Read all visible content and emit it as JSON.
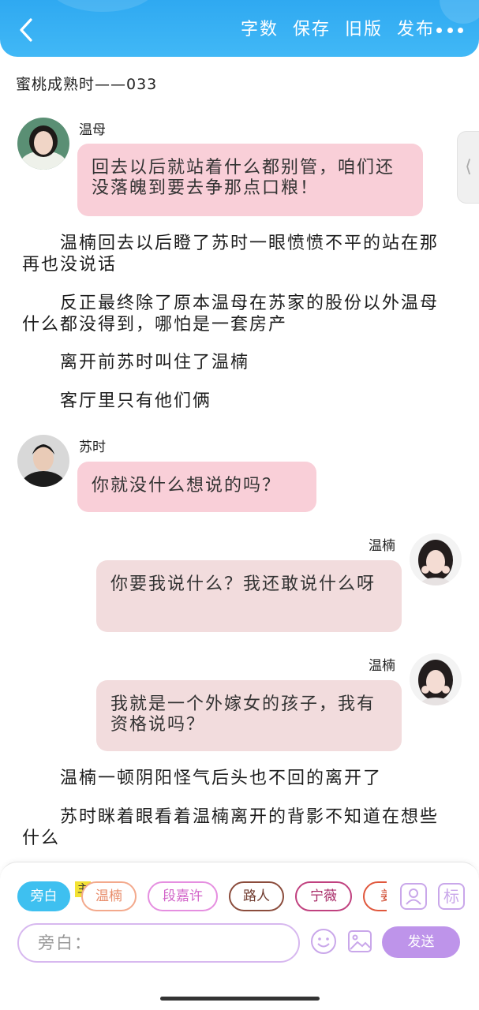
{
  "header": {
    "actions": [
      "字数",
      "保存",
      "旧版",
      "发布"
    ]
  },
  "document": {
    "title": "蜜桃成熟时——033"
  },
  "side_tab": {
    "label": "⟨"
  },
  "chat": [
    {
      "speaker": "温母",
      "text": "回去以后就站着什么都别管，咱们还没落魄到要去争那点口粮！"
    },
    {
      "speaker": "苏时",
      "text": "你就没什么想说的吗？"
    },
    {
      "speaker": "温楠",
      "text": "你要我说什么？我还敢说什么呀"
    },
    {
      "speaker": "温楠",
      "text": "我就是一个外嫁女的孩子，我有资格说吗？"
    }
  ],
  "narration": [
    "温楠回去以后瞪了苏时一眼愤愤不平的站在那再也没说话",
    "反正最终除了原本温母在苏家的股份以外温母什么都没得到，哪怕是一套房产",
    "离开前苏时叫住了温楠",
    "客厅里只有他们俩",
    "温楠一顿阴阳怪气后头也不回的离开了",
    "苏时眯着眼看着温楠离开的背影不知道在想些什么"
  ],
  "role_bar": {
    "main_badge": "主",
    "roles": [
      {
        "label": "旁白",
        "color": "#3ec0f0",
        "active": true
      },
      {
        "label": "温楠",
        "color": "#f3a98c",
        "active": false
      },
      {
        "label": "段嘉许",
        "color": "#e58fe0",
        "active": false
      },
      {
        "label": "路人",
        "color": "#8b4c3c",
        "active": false
      },
      {
        "label": "宁薇",
        "color": "#c0417f",
        "active": false
      },
      {
        "label": "姜",
        "color": "#e0573c",
        "active": false
      }
    ],
    "icons": [
      "add-role-icon",
      "mark-icon"
    ],
    "mark_label": "标"
  },
  "composer": {
    "placeholder": "旁白：",
    "send_label": "发送"
  },
  "colors": {
    "header_blue": "#38b0f4",
    "bubble_pink": "#f9cfd8",
    "bubble_rose": "#f2dcdd",
    "accent_purple": "#be94ea"
  }
}
